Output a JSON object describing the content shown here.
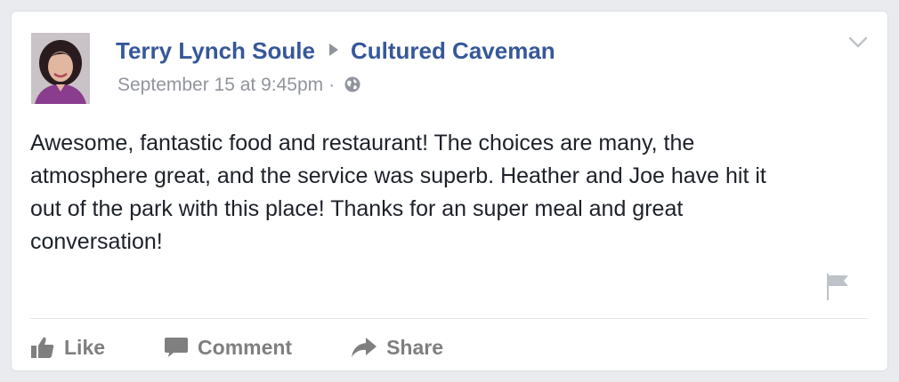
{
  "post": {
    "author": "Terry Lynch Soule",
    "target_page": "Cultured Caveman",
    "timestamp": "September 15 at 9:45pm",
    "separator": "·",
    "privacy_icon": "globe-icon",
    "text": "Awesome, fantastic food and restaurant! The choices are many, the\natmosphere great, and the service was superb. Heather and Joe have hit it\nout of the park with this place! Thanks for an super meal and great\nconversation!",
    "avatar_icon": "profile-photo",
    "menu_icon": "chevron-down-icon",
    "report_icon": "flag-icon"
  },
  "actions": {
    "like_label": "Like",
    "comment_label": "Comment",
    "share_label": "Share"
  },
  "colors": {
    "link": "#365899",
    "meta": "#90949c",
    "body_text": "#1d2129",
    "action": "#7f7f7f",
    "background": "#e9ebee"
  }
}
